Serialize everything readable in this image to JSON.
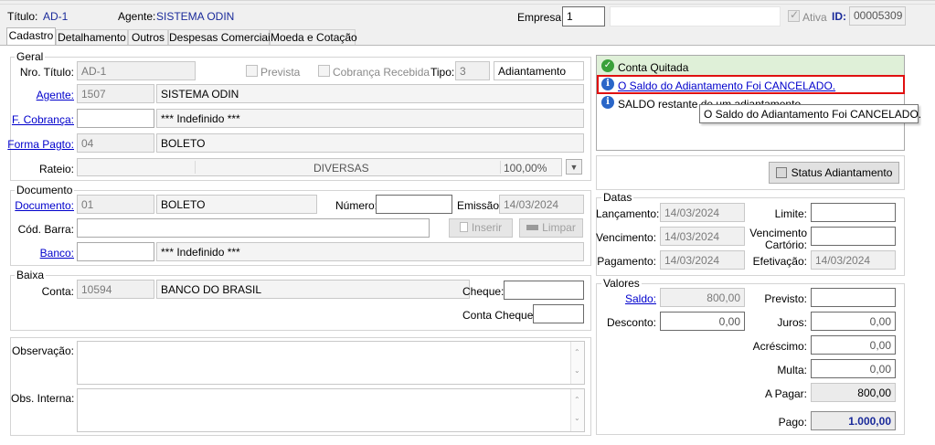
{
  "header": {
    "titulo_label": "Título:",
    "titulo_value": "AD-1",
    "agente_label": "Agente:",
    "agente_value": "SISTEMA ODIN",
    "empresa_label": "Empresa:",
    "empresa_value": "1",
    "ativa_label": "Ativa",
    "id_label": "ID:",
    "id_value": "00005309"
  },
  "tabs": [
    "Cadastro",
    "Detalhamento",
    "Outros",
    "Despesas Comerciais",
    "Moeda e Cotação"
  ],
  "geral": {
    "title": "Geral",
    "nro_titulo_label": "Nro. Título:",
    "nro_titulo_value": "AD-1",
    "prevista_label": "Prevista",
    "cobranca_recebida_label": "Cobrança Recebida",
    "tipo_label": "Tipo:",
    "tipo_code": "3",
    "tipo_desc": "Adiantamento",
    "agente_label": "Agente:",
    "agente_code": "1507",
    "agente_desc": "SISTEMA ODIN",
    "f_cobranca_label": "F. Cobrança:",
    "f_cobranca_code": "",
    "f_cobranca_desc": "*** Indefinido ***",
    "forma_pagto_label": "Forma Pagto:",
    "forma_pagto_code": "04",
    "forma_pagto_desc": "BOLETO",
    "rateio_label": "Rateio:",
    "rateio_desc": "DIVERSAS",
    "rateio_pct": "100,00%"
  },
  "documento": {
    "title": "Documento",
    "documento_label": "Documento:",
    "documento_code": "01",
    "documento_desc": "BOLETO",
    "numero_label": "Número:",
    "numero_value": "",
    "emissao_label": "Emissão:",
    "emissao_value": "14/03/2024",
    "cod_barra_label": "Cód. Barra:",
    "cod_barra_value": "",
    "inserir_label": "Inserir",
    "limpar_label": "Limpar",
    "banco_label": "Banco:",
    "banco_code": "",
    "banco_desc": "*** Indefinido ***"
  },
  "baixa": {
    "title": "Baixa",
    "conta_label": "Conta:",
    "conta_code": "10594",
    "conta_desc": "BANCO DO BRASIL",
    "cheque_label": "Cheque:",
    "conta_cheque_label": "Conta Cheque:"
  },
  "obs": {
    "observacao_label": "Observação:",
    "obs_interna_label": "Obs. Interna:"
  },
  "messages": {
    "conta_quitada": "Conta Quitada",
    "saldo_cancelado_link": "O Saldo do Adiantamento Foi CANCELADO.",
    "saldo_restante": "SALDO restante de um adiantamento",
    "tooltip": "O Saldo do Adiantamento Foi CANCELADO."
  },
  "status_button_label": "Status Adiantamento",
  "datas": {
    "title": "Datas",
    "lancamento_label": "Lançamento:",
    "lancamento_value": "14/03/2024",
    "limite_label": "Limite:",
    "limite_value": "",
    "vencimento_label": "Vencimento:",
    "vencimento_value": "14/03/2024",
    "venc_cartorio_label_1": "Vencimento",
    "venc_cartorio_label_2": "Cartório:",
    "venc_cartorio_value": "",
    "pagamento_label": "Pagamento:",
    "pagamento_value": "14/03/2024",
    "efetivacao_label": "Efetivação:",
    "efetivacao_value": "14/03/2024"
  },
  "valores": {
    "title": "Valores",
    "saldo_label": "Saldo:",
    "saldo_value": "800,00",
    "previsto_label": "Previsto:",
    "previsto_value": "",
    "desconto_label": "Desconto:",
    "desconto_value": "0,00",
    "juros_label": "Juros:",
    "juros_value": "0,00",
    "acrescimo_label": "Acréscimo:",
    "acrescimo_value": "0,00",
    "multa_label": "Multa:",
    "multa_value": "0,00",
    "a_pagar_label": "A Pagar:",
    "a_pagar_value": "800,00",
    "pago_label": "Pago:",
    "pago_value": "1.000,00"
  },
  "colors": {
    "accent_red": "#e01010",
    "link_blue": "#0000cc",
    "ok_green": "#3aa03a",
    "info_blue": "#2a66c8",
    "pago_blue": "#1a2a9a"
  }
}
